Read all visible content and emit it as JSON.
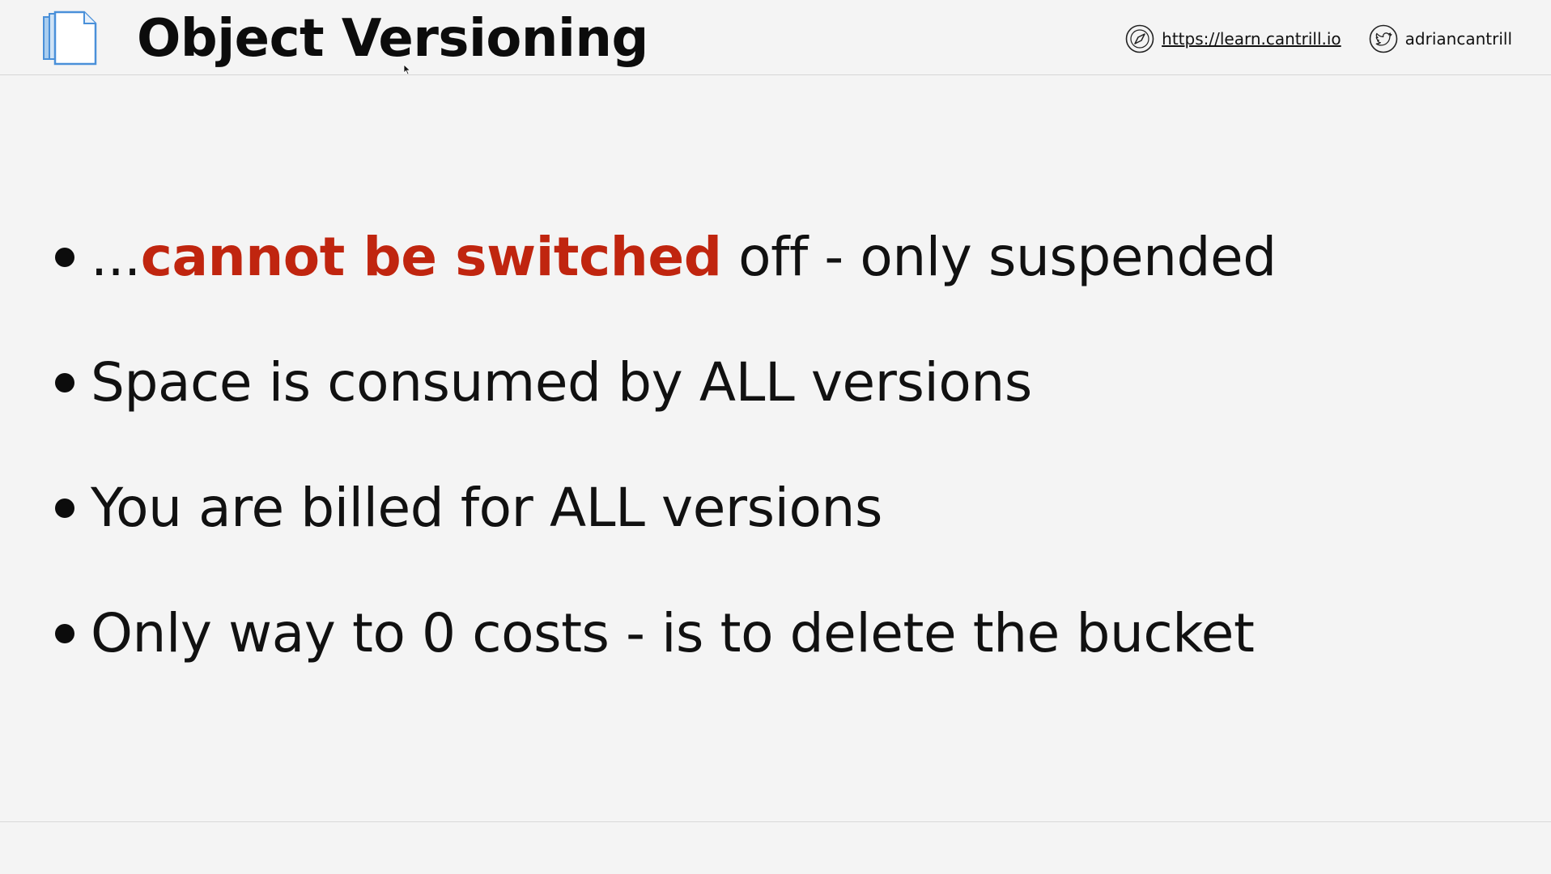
{
  "header": {
    "title": "Object Versioning",
    "logo_icon": "document-stack-icon",
    "website": {
      "icon": "compass-icon",
      "label": "https://learn.cantrill.io"
    },
    "twitter": {
      "icon": "twitter-bird-icon",
      "label": "adriancantrill"
    }
  },
  "bullets": [
    {
      "prefix": "...",
      "emphasis": "cannot be switched",
      "suffix": " off - only suspended"
    },
    {
      "text": "Space is consumed by ALL versions"
    },
    {
      "text": "You are billed for ALL versions"
    },
    {
      "text": "Only way to 0 costs - is to delete the bucket"
    }
  ],
  "colors": {
    "background": "#f4f4f4",
    "emphasis": "#c0250f",
    "text": "#111111",
    "logo_blue": "#4a90d9"
  }
}
